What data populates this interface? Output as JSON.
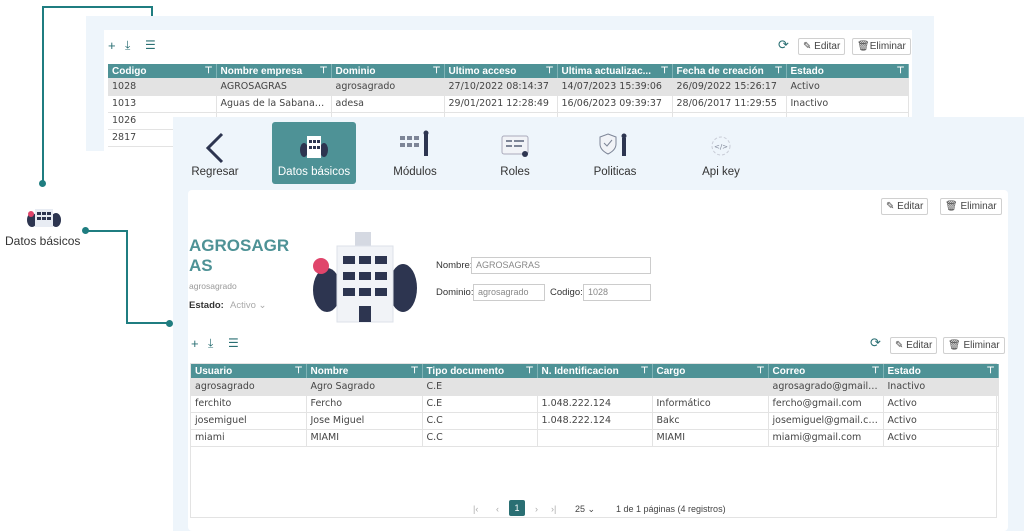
{
  "back_panel": {
    "toolbar": {
      "edit_label": "Editar",
      "delete_label": "Eliminar"
    },
    "columns": [
      "Codigo",
      "Nombre empresa",
      "Dominio",
      "Ultimo acceso",
      "Ultima actualizac...",
      "Fecha de creación",
      "Estado"
    ],
    "rows": [
      [
        "1028",
        "AGROSAGRAS",
        "agrosagrado",
        "27/10/2022 08:14:37",
        "14/07/2023 15:39:06",
        "26/09/2022 15:26:17",
        "Activo"
      ],
      [
        "1013",
        "Aguas de la Sabana (AD...",
        "adesa",
        "29/01/2021 12:28:49",
        "16/06/2023 09:39:37",
        "28/06/2017 11:29:55",
        "Inactivo"
      ],
      [
        "1026",
        "",
        "",
        "",
        "",
        "",
        ""
      ],
      [
        "2817",
        "",
        "",
        "",
        "",
        "",
        ""
      ]
    ]
  },
  "callout": {
    "label": "Datos básicos"
  },
  "nav": {
    "back": "Regresar",
    "items": [
      "Datos básicos",
      "Módulos",
      "Roles",
      "Politicas",
      "Api key"
    ]
  },
  "detail": {
    "edit_label": "Editar",
    "delete_label": "Eliminar",
    "company_title_line1": "AGROSAGR",
    "company_title_line2": "AS",
    "domain_sub": "agrosagrado",
    "status_label": "Estado:",
    "status_value": "Activo",
    "name_label": "Nombre:",
    "name_value": "AGROSAGRAS",
    "domain_label": "Dominio:",
    "domain_value": "agrosagrado",
    "code_label": "Codigo:",
    "code_value": "1028"
  },
  "users": {
    "edit_label": "Editar",
    "delete_label": "Eliminar",
    "columns": [
      "Usuario",
      "Nombre",
      "Tipo documento",
      "N. Identificacion",
      "Cargo",
      "Correo",
      "Estado"
    ],
    "rows": [
      [
        "agrosagrado",
        "Agro Sagrado",
        "C.E",
        "",
        "",
        "agrosagrado@gmail.com",
        "Inactivo"
      ],
      [
        "ferchito",
        "Fercho",
        "C.E",
        "1.048.222.124",
        "Informático",
        "fercho@gmail.com",
        "Activo"
      ],
      [
        "josemiguel",
        "Jose Miguel",
        "C.C",
        "1.048.222.124",
        "Bakc",
        "josemiguel@gmail.com",
        "Activo"
      ],
      [
        "miami",
        "MIAMI",
        "C.C",
        "",
        "MIAMI",
        "miami@gmail.com",
        "Activo"
      ]
    ],
    "pager": {
      "page": "1",
      "page_size": "25",
      "summary": "1 de 1 páginas (4 registros)"
    }
  },
  "colors": {
    "accent": "#4e9296",
    "connector": "#1f7d80"
  }
}
